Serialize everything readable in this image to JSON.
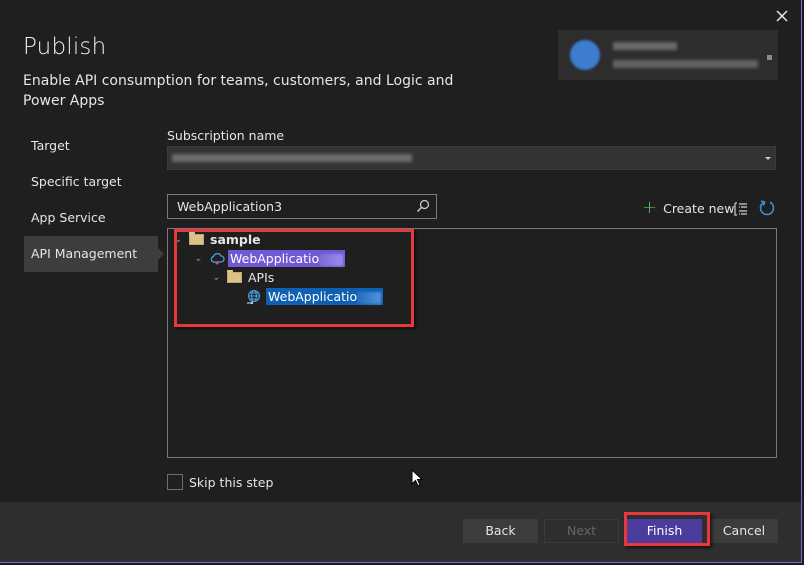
{
  "dialog": {
    "title": "Publish",
    "subtitle": "Enable API consumption for teams, customers, and Logic and Power Apps",
    "close_icon": "close-icon"
  },
  "account": {
    "name": "[redacted]",
    "email": "[redacted]"
  },
  "nav": {
    "items": [
      {
        "label": "Target",
        "active": false
      },
      {
        "label": "Specific target",
        "active": false
      },
      {
        "label": "App Service",
        "active": false
      },
      {
        "label": "API Management",
        "active": true
      }
    ]
  },
  "subscription": {
    "label": "Subscription name",
    "value": "[redacted]"
  },
  "search": {
    "value": "WebApplication3",
    "icon": "search-icon"
  },
  "toolbar": {
    "create_new_label": "Create new",
    "create_new_icon": "plus-icon",
    "tree_view_icon": "tree-view-icon",
    "refresh_icon": "refresh-icon"
  },
  "tree": {
    "nodes": [
      {
        "label": "sample",
        "type": "folder",
        "level": 0,
        "expanded": true
      },
      {
        "label": "WebApplicatio",
        "type": "api-management-service",
        "level": 1,
        "expanded": true,
        "selected": "purple"
      },
      {
        "label": "APIs",
        "type": "folder",
        "level": 2,
        "expanded": true
      },
      {
        "label": "WebApplicatio",
        "type": "api",
        "level": 3,
        "selected": "blue"
      }
    ]
  },
  "skip": {
    "label": "Skip this step",
    "checked": false
  },
  "footer": {
    "back_label": "Back",
    "next_label": "Next",
    "finish_label": "Finish",
    "cancel_label": "Cancel"
  },
  "colors": {
    "accent_purple": "#7159d4",
    "finish_button": "#4b3b9d",
    "selection_blue": "#0f5fb3",
    "highlight_red": "#e8383d",
    "create_new_plus": "#4fc95a",
    "refresh_blue": "#3e8ed0"
  }
}
